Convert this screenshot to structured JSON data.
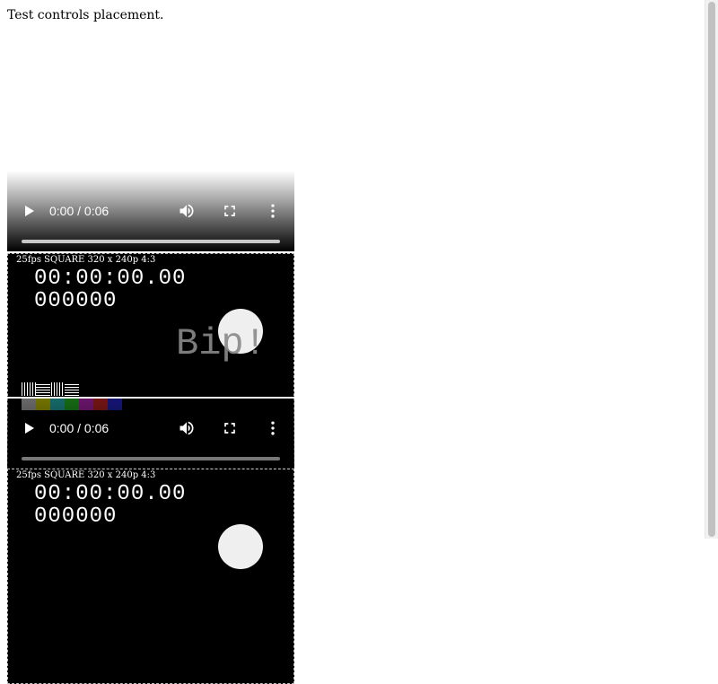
{
  "page": {
    "text": "Test controls placement."
  },
  "player": {
    "time_display": "0:00 / 0:06"
  },
  "frame": {
    "meta": "25fps SQUARE 320 x 240p 4:3",
    "timecode": "00:00:00.00",
    "frame_count": "000000",
    "overlay_text": "Bip!"
  },
  "icons": {
    "play": "play-icon",
    "volume": "volume-icon",
    "fullscreen": "fullscreen-icon",
    "menu": "more-options-icon"
  },
  "colors": {
    "bars": [
      "#a0a0a0",
      "#b0b000",
      "#20a0a0",
      "#20a020",
      "#a020a0",
      "#b02020",
      "#2020b0"
    ]
  }
}
